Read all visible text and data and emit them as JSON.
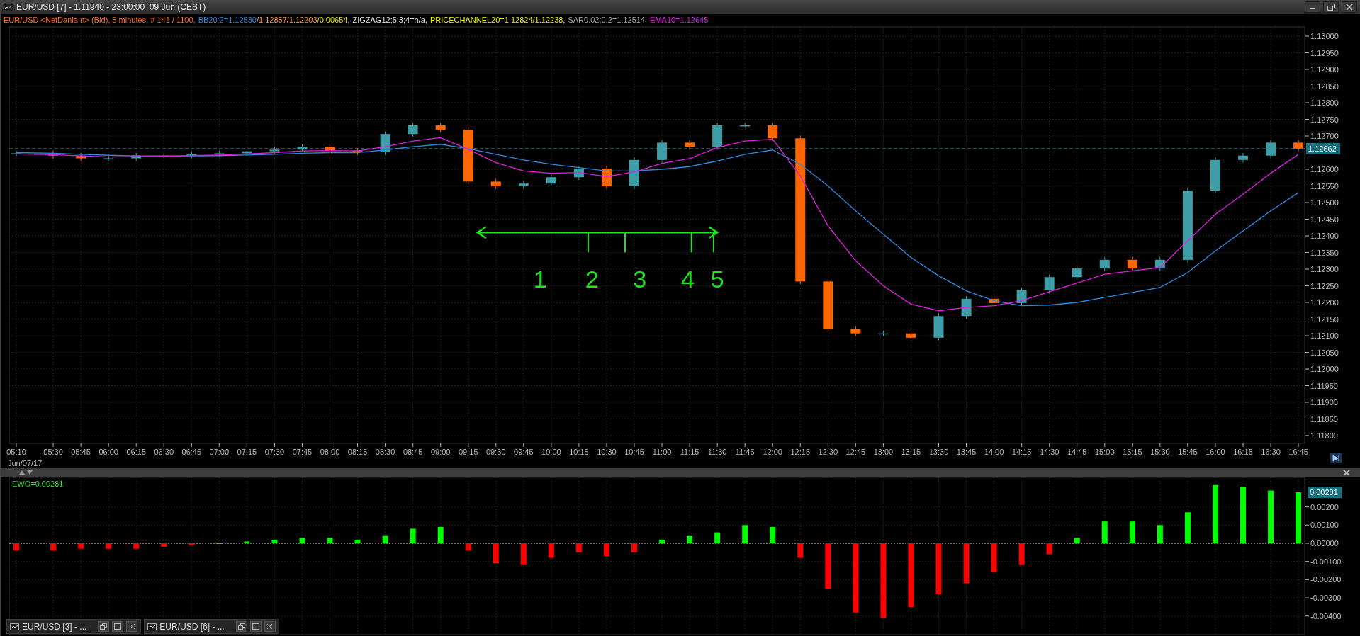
{
  "window": {
    "title": "EUR/USD [7] - 1.11940 - 23:00:00  09 Jun (CEST)"
  },
  "legend": [
    {
      "parts": [
        {
          "kind": "text",
          "text": "EUR/USD <NetDania rt> (Bid), 5 minutes, # 141 / 1100,",
          "color": "#ff6a10"
        }
      ]
    },
    {
      "parts": [
        {
          "kind": "series"
        },
        {
          "kind": "text",
          "text": "/1.12857/1.12203",
          "color": "#ff9a30"
        },
        {
          "kind": "text",
          "text": "/0.00654,",
          "color": "#e8e800"
        }
      ]
    },
    {
      "parts": [
        {
          "kind": "text",
          "text": "ZIGZAG12;5;3;4=n/a,",
          "color": "#e8e8e8"
        }
      ]
    },
    {
      "parts": [
        {
          "kind": "text",
          "text": "PRICECHANNEL20=1.12824/1.12238,",
          "color": "#f0f000"
        }
      ]
    },
    {
      "parts": [
        {
          "kind": "text",
          "text": "SAR0.02;0.2=1.12514,",
          "color": "#a8a8a8"
        }
      ]
    },
    {
      "parts": [
        {
          "kind": "series"
        }
      ]
    }
  ],
  "price_chart": {
    "date_label": "Jun/07/17",
    "chart_data": {
      "type": "candlestick",
      "grid": true,
      "categories": [
        "05:10",
        "05:30",
        "05:45",
        "06:00",
        "06:15",
        "06:30",
        "06:45",
        "07:00",
        "07:15",
        "07:30",
        "07:45",
        "08:00",
        "08:15",
        "08:30",
        "08:45",
        "09:00",
        "09:15",
        "09:30",
        "09:45",
        "10:00",
        "10:15",
        "10:30",
        "10:45",
        "11:00",
        "11:15",
        "11:30",
        "11:45",
        "12:00",
        "12:15",
        "12:30",
        "12:45",
        "13:00",
        "13:15",
        "13:30",
        "13:45",
        "14:00",
        "14:15",
        "14:30",
        "14:45",
        "15:00",
        "15:15",
        "15:30",
        "15:45",
        "16:00",
        "16:15",
        "16:30",
        "16:45"
      ],
      "ohlc": [
        [
          1.12648,
          1.12656,
          1.1264,
          1.12648
        ],
        [
          1.12648,
          1.12656,
          1.12633,
          1.12641
        ],
        [
          1.12641,
          1.12649,
          1.12625,
          1.12633
        ],
        [
          1.12633,
          1.12641,
          1.12625,
          1.12633
        ],
        [
          1.12633,
          1.12649,
          1.12625,
          1.12641
        ],
        [
          1.12641,
          1.12649,
          1.12633,
          1.12641
        ],
        [
          1.12641,
          1.12654,
          1.12633,
          1.12646
        ],
        [
          1.12646,
          1.12656,
          1.12638,
          1.12648
        ],
        [
          1.12648,
          1.12662,
          1.1264,
          1.12654
        ],
        [
          1.12654,
          1.12667,
          1.12646,
          1.12659
        ],
        [
          1.12659,
          1.12675,
          1.12651,
          1.12667
        ],
        [
          1.12667,
          1.12675,
          1.12636,
          1.12656
        ],
        [
          1.12656,
          1.12664,
          1.12643,
          1.12651
        ],
        [
          1.12651,
          1.12714,
          1.12643,
          1.12706
        ],
        [
          1.12706,
          1.1274,
          1.12698,
          1.12732
        ],
        [
          1.12732,
          1.1274,
          1.12711,
          1.12719
        ],
        [
          1.12719,
          1.12727,
          1.12555,
          1.12563
        ],
        [
          1.12563,
          1.12571,
          1.12541,
          1.12549
        ],
        [
          1.12549,
          1.12565,
          1.12541,
          1.12557
        ],
        [
          1.12557,
          1.12584,
          1.12549,
          1.12576
        ],
        [
          1.12576,
          1.1261,
          1.12568,
          1.12602
        ],
        [
          1.12602,
          1.1261,
          1.12541,
          1.12549
        ],
        [
          1.12549,
          1.12636,
          1.12541,
          1.12628
        ],
        [
          1.12628,
          1.12688,
          1.1262,
          1.1268
        ],
        [
          1.1268,
          1.12688,
          1.12659,
          1.12667
        ],
        [
          1.12667,
          1.1274,
          1.12659,
          1.12732
        ],
        [
          1.12732,
          1.1274,
          1.12724,
          1.12732
        ],
        [
          1.12732,
          1.1274,
          1.12685,
          1.12693
        ],
        [
          1.12693,
          1.12701,
          1.12255,
          1.12263
        ],
        [
          1.12263,
          1.12271,
          1.12112,
          1.1212
        ],
        [
          1.1212,
          1.12128,
          1.12099,
          1.12107
        ],
        [
          1.12107,
          1.12115,
          1.12099,
          1.12107
        ],
        [
          1.12107,
          1.12115,
          1.12086,
          1.12094
        ],
        [
          1.12094,
          1.12167,
          1.12086,
          1.12159
        ],
        [
          1.12159,
          1.12219,
          1.12151,
          1.12211
        ],
        [
          1.12211,
          1.12219,
          1.1219,
          1.12198
        ],
        [
          1.12198,
          1.12245,
          1.1219,
          1.12237
        ],
        [
          1.12237,
          1.12284,
          1.12229,
          1.12276
        ],
        [
          1.12276,
          1.1231,
          1.12268,
          1.12302
        ],
        [
          1.12302,
          1.12336,
          1.12294,
          1.12328
        ],
        [
          1.12328,
          1.12336,
          1.12294,
          1.12302
        ],
        [
          1.12302,
          1.12336,
          1.12294,
          1.12328
        ],
        [
          1.12328,
          1.12544,
          1.1232,
          1.12536
        ],
        [
          1.12536,
          1.12636,
          1.12528,
          1.12628
        ],
        [
          1.12628,
          1.12649,
          1.1262,
          1.12641
        ],
        [
          1.12641,
          1.12688,
          1.12633,
          1.1268
        ],
        [
          1.1268,
          1.12688,
          1.12654,
          1.12662
        ]
      ],
      "series": [
        {
          "name": "BB20;2=1.12530",
          "type": "line",
          "color": "#2a8ae0",
          "values": [
            1.1265,
            1.12648,
            1.12645,
            1.12642,
            1.1264,
            1.1264,
            1.1264,
            1.12641,
            1.12643,
            1.12645,
            1.12648,
            1.1265,
            1.1265,
            1.12658,
            1.12668,
            1.12675,
            1.12662,
            1.12645,
            1.12628,
            1.12615,
            1.12605,
            1.12595,
            1.12595,
            1.126,
            1.12608,
            1.12625,
            1.12645,
            1.12658,
            1.12615,
            1.1255,
            1.12475,
            1.12405,
            1.12335,
            1.1228,
            1.12235,
            1.12205,
            1.1219,
            1.12192,
            1.122,
            1.12215,
            1.1223,
            1.12245,
            1.1229,
            1.12355,
            1.12415,
            1.12475,
            1.1253
          ]
        },
        {
          "name": "EMA10=1.12645",
          "type": "line",
          "color": "#e020e0",
          "values": [
            1.12646,
            1.12644,
            1.1264,
            1.12637,
            1.12638,
            1.12639,
            1.12641,
            1.12643,
            1.12646,
            1.1265,
            1.12655,
            1.12656,
            1.12655,
            1.12668,
            1.12685,
            1.12695,
            1.1266,
            1.1262,
            1.12595,
            1.12588,
            1.1259,
            1.12578,
            1.12592,
            1.12618,
            1.12632,
            1.12665,
            1.12685,
            1.1269,
            1.1258,
            1.1243,
            1.12325,
            1.1225,
            1.12195,
            1.12175,
            1.12185,
            1.1219,
            1.12205,
            1.12232,
            1.12258,
            1.12285,
            1.12295,
            1.12305,
            1.12385,
            1.12465,
            1.12525,
            1.12588,
            1.12645
          ]
        }
      ],
      "ylim": [
        1.118,
        1.13
      ],
      "yticks": [
        {
          "value": 1.13,
          "label": "1.13000"
        },
        {
          "value": 1.1295,
          "label": "1.12950"
        },
        {
          "value": 1.129,
          "label": "1.12900"
        },
        {
          "value": 1.1285,
          "label": "1.12850"
        },
        {
          "value": 1.128,
          "label": "1.12800"
        },
        {
          "value": 1.1275,
          "label": "1.12750"
        },
        {
          "value": 1.127,
          "label": "1.12700"
        },
        {
          "value": 1.126,
          "label": "1.12600"
        },
        {
          "value": 1.1255,
          "label": "1.12550"
        },
        {
          "value": 1.125,
          "label": "1.12500"
        },
        {
          "value": 1.1245,
          "label": "1.12450"
        },
        {
          "value": 1.124,
          "label": "1.12400"
        },
        {
          "value": 1.1235,
          "label": "1.12350"
        },
        {
          "value": 1.123,
          "label": "1.12300"
        },
        {
          "value": 1.1225,
          "label": "1.12250"
        },
        {
          "value": 1.122,
          "label": "1.12200"
        },
        {
          "value": 1.1215,
          "label": "1.12150"
        },
        {
          "value": 1.121,
          "label": "1.12100"
        },
        {
          "value": 1.1205,
          "label": "1.12050"
        },
        {
          "value": 1.12,
          "label": "1.12000"
        },
        {
          "value": 1.1195,
          "label": "1.11950"
        },
        {
          "value": 1.119,
          "label": "1.11900"
        },
        {
          "value": 1.1185,
          "label": "1.11850"
        },
        {
          "value": 1.118,
          "label": "1.11800"
        }
      ],
      "ref_lines": [
        {
          "axis": "y",
          "value": 1.12662,
          "label": "1.12662"
        }
      ],
      "annotations": [
        "1",
        "2",
        "3",
        "4",
        "5"
      ]
    }
  },
  "ewo_panel": {
    "label": "EWO=0.00281",
    "last_value": "0.00281",
    "chart_data": {
      "type": "bar",
      "grid": true,
      "ylim": [
        -0.00502,
        0.00362
      ],
      "series": [
        {
          "color": "#00ff00",
          "values": [
            null,
            null,
            null,
            null,
            null,
            null,
            null,
            0.0,
            0.0001,
            0.0002,
            0.0003,
            0.0003,
            0.0002,
            0.0004,
            0.0008,
            0.0009,
            null,
            null,
            null,
            null,
            null,
            null,
            null,
            0.0002,
            0.0004,
            0.0006,
            0.001,
            0.0009,
            null,
            null,
            null,
            null,
            null,
            null,
            null,
            null,
            null,
            null,
            0.0003,
            0.0012,
            0.0012,
            0.001,
            0.0017,
            0.0032,
            0.0031,
            0.0029,
            0.0028
          ]
        },
        {
          "color": "#ff0000",
          "values": [
            -0.0004,
            -0.0004,
            -0.0003,
            -0.0003,
            -0.0003,
            -0.0002,
            -0.0001,
            null,
            null,
            null,
            null,
            null,
            null,
            null,
            null,
            null,
            -0.0004,
            -0.0011,
            -0.0012,
            -0.0008,
            -0.0005,
            -0.0007,
            -0.0005,
            null,
            null,
            null,
            null,
            null,
            -0.0008,
            -0.0025,
            -0.0038,
            -0.0041,
            -0.0035,
            -0.0028,
            -0.0022,
            -0.0016,
            -0.0012,
            -0.0006,
            null,
            null,
            null,
            null,
            null,
            null,
            null,
            null,
            null
          ]
        }
      ],
      "yticks": [
        {
          "value": 0.002,
          "label": "0.00200"
        },
        {
          "value": 0.001,
          "label": "0.00100"
        },
        {
          "value": 0,
          "label": "0.00000"
        },
        {
          "value": -0.001,
          "label": "-0.00100"
        },
        {
          "value": -0.002,
          "label": "-0.00200"
        },
        {
          "value": -0.003,
          "label": "-0.00300"
        },
        {
          "value": -0.004,
          "label": "-0.00400"
        }
      ],
      "ref_lines": [
        {
          "axis": "y",
          "value": 0
        }
      ]
    }
  },
  "minimized_windows": [
    {
      "title": "EUR/USD [3] - ..."
    },
    {
      "title": "EUR/USD [6] - ..."
    }
  ]
}
